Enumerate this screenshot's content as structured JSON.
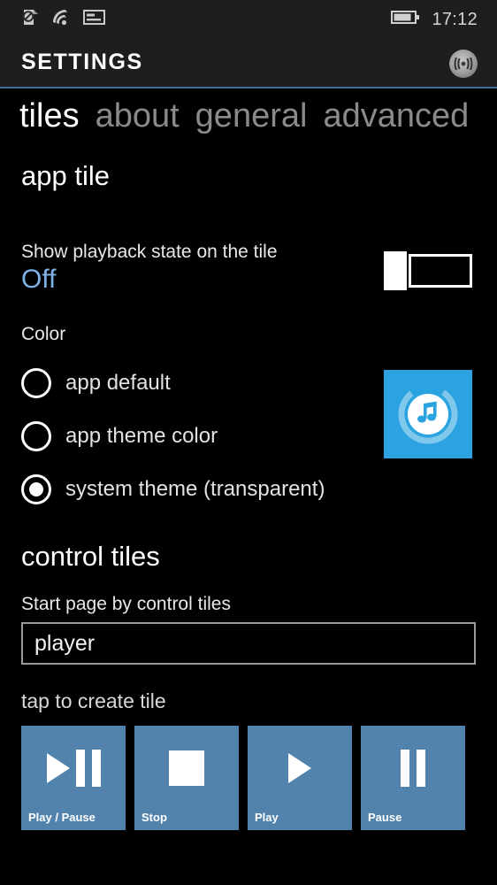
{
  "statusbar": {
    "icons": [
      "cellular-off-icon",
      "wifi-icon",
      "sim-card-icon"
    ],
    "battery_icon": "battery-icon",
    "time": "17:12"
  },
  "header": {
    "title": "SETTINGS",
    "logo_icon": "disc-app-logo-icon"
  },
  "pivot": {
    "tabs": [
      {
        "label": "tiles",
        "active": true
      },
      {
        "label": "about",
        "active": false
      },
      {
        "label": "general",
        "active": false
      },
      {
        "label": "advanced",
        "active": false
      }
    ]
  },
  "app_tile": {
    "heading": "app tile",
    "toggle_label": "Show playback state on the tile",
    "toggle_value": "Off",
    "toggle_state": "off",
    "color_label": "Color",
    "color_options": [
      {
        "label": "app default",
        "selected": false
      },
      {
        "label": "app theme color",
        "selected": false
      },
      {
        "label": "system theme (transparent)",
        "selected": true
      }
    ],
    "preview_icon": "music-note-tile-icon",
    "preview_color": "#2ba3e0"
  },
  "control_tiles": {
    "heading": "control tiles",
    "start_page_label": "Start page by control tiles",
    "start_page_value": "player",
    "tap_label": "tap to create tile",
    "tiles": [
      {
        "name": "Play / Pause",
        "glyph": "play-pause-icon"
      },
      {
        "name": "Stop",
        "glyph": "stop-icon"
      },
      {
        "name": "Play",
        "glyph": "play-icon"
      },
      {
        "name": "Pause",
        "glyph": "pause-icon"
      }
    ],
    "tile_color": "#5183ad"
  },
  "colors": {
    "accent": "#7eb2e8",
    "divider": "#3e6f9e",
    "background": "#000000",
    "chrome": "#1e1e1e"
  }
}
